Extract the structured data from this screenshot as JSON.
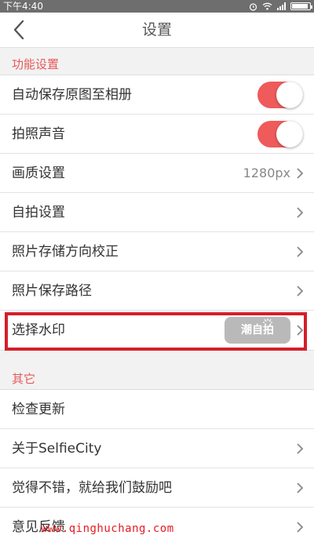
{
  "status_bar": {
    "time": "下午4:40"
  },
  "header": {
    "title": "设置"
  },
  "sections": {
    "features": {
      "label": "功能设置",
      "rows": [
        {
          "label": "自动保存原图至相册",
          "toggle": true
        },
        {
          "label": "拍照声音",
          "toggle": true
        },
        {
          "label": "画质设置",
          "value": "1280px"
        },
        {
          "label": "自拍设置"
        },
        {
          "label": "照片存储方向校正"
        },
        {
          "label": "照片保存路径"
        },
        {
          "label": "选择水印",
          "badge": "潮自拍"
        }
      ]
    },
    "other": {
      "label": "其它",
      "rows": [
        {
          "label": "检查更新"
        },
        {
          "label": "关于SelfieCity"
        },
        {
          "label": "觉得不错，就给我们鼓励吧"
        },
        {
          "label": "意见反馈"
        }
      ]
    }
  },
  "watermark_text": "www.qinghuchang.com",
  "colors": {
    "accent": "#e8585a",
    "toggle_on": "#ef5a5a",
    "highlight": "#d61e2a"
  },
  "battery_level": 0.9
}
